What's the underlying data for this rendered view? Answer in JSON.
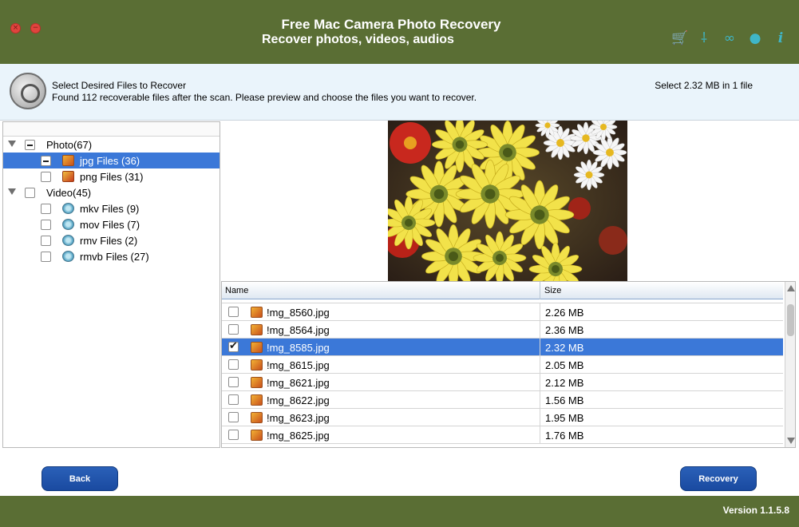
{
  "header": {
    "title": "Free Mac Camera Photo Recovery",
    "subtitle": "Recover photos, videos, audios",
    "window_buttons": [
      {
        "icon": "close-icon",
        "glyph": "×"
      },
      {
        "icon": "minimize-icon",
        "glyph": "−"
      }
    ],
    "icons": [
      {
        "name": "cart-icon",
        "glyph": "🛒"
      },
      {
        "name": "brush-icon",
        "glyph": "⸸"
      },
      {
        "name": "link-icon",
        "glyph": "∞"
      },
      {
        "name": "globe-icon",
        "glyph": "●"
      },
      {
        "name": "info-icon",
        "glyph": "i"
      }
    ],
    "accent_color": "#3fb6c8"
  },
  "infobar": {
    "heading": "Select Desired Files to Recover",
    "message": "Found 112 recoverable files after the scan. Please preview and choose the files you want to recover.",
    "selection_prefix": "Select",
    "selection_size": "2.32 MB",
    "selection_mid": "in",
    "selection_count": "1",
    "selection_suffix": "file"
  },
  "tree": {
    "photo": {
      "label": "Photo(67)"
    },
    "jpg": {
      "label": "jpg Files (36)"
    },
    "png": {
      "label": "png Files (31)"
    },
    "video": {
      "label": "Video(45)"
    },
    "mkv": {
      "label": "mkv Files (9)"
    },
    "mov": {
      "label": "mov Files (7)"
    },
    "rmv": {
      "label": "rmv Files (2)"
    },
    "rmvb": {
      "label": "rmvb Files (27)"
    }
  },
  "table": {
    "col_name": "Name",
    "col_size": "Size",
    "rows": [
      {
        "name": "!mg_8560.jpg",
        "size": "2.26 MB",
        "checked": false
      },
      {
        "name": "!mg_8564.jpg",
        "size": "2.36 MB",
        "checked": false
      },
      {
        "name": "!mg_8585.jpg",
        "size": "2.32 MB",
        "checked": true
      },
      {
        "name": "!mg_8615.jpg",
        "size": "2.05 MB",
        "checked": false
      },
      {
        "name": "!mg_8621.jpg",
        "size": "2.12 MB",
        "checked": false
      },
      {
        "name": "!mg_8622.jpg",
        "size": "1.56 MB",
        "checked": false
      },
      {
        "name": "!mg_8623.jpg",
        "size": "1.95 MB",
        "checked": false
      },
      {
        "name": "!mg_8625.jpg",
        "size": "1.76 MB",
        "checked": false
      }
    ]
  },
  "buttons": {
    "back": "Back",
    "recovery": "Recovery"
  },
  "footer": {
    "version": "Version 1.1.5.8"
  },
  "colors": {
    "header_bg": "#5a6e34",
    "selection_blue": "#3b78d8",
    "button_blue": "#1f52aa"
  }
}
